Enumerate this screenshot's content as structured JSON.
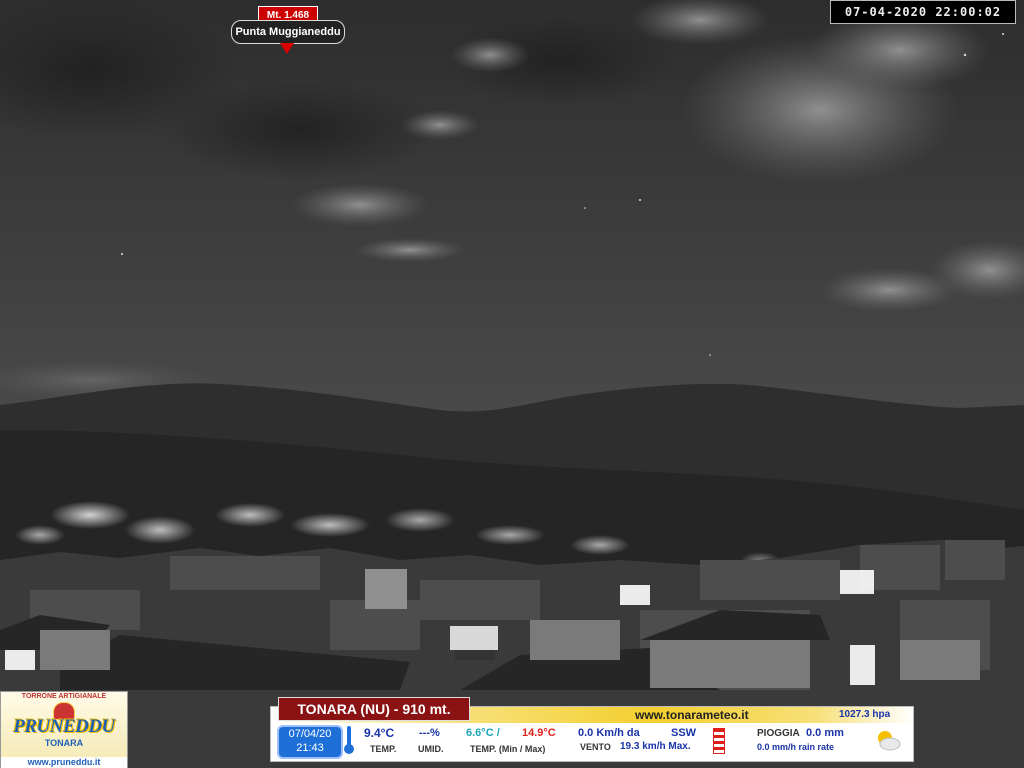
{
  "webcam": {
    "timestamp": "07-04-2020  22:00:02",
    "landmark": {
      "altitude": "Mt. 1.468",
      "name": "Punta Muggianeddu"
    }
  },
  "sponsor": {
    "tagline": "TORRONE ARTIGIANALE",
    "brand": "PRUNEDDU",
    "town": "TONARA",
    "url": "www.pruneddu.it"
  },
  "weather": {
    "station": "TONARA (NU) - 910 mt.",
    "site": "www.tonarameteo.it",
    "pressure": "1027.3  hpa",
    "date": "07/04/20",
    "time": "21:43",
    "temp": "9.4°C",
    "temp_label": "TEMP.",
    "humidity": "---%",
    "humidity_label": "UMID.",
    "temp_min": "6.6°C /",
    "temp_max": "14.9°C",
    "minmax_label": "TEMP. (Min / Max)",
    "wind": "0.0 Km/h da",
    "wind_dir": "SSW",
    "wind_label": "VENTO",
    "wind_max": "19.3  km/h Max.",
    "rain_label": "PIOGGIA",
    "rain": "0.0 mm",
    "rain_rate": "0.0 mm/h rain rate",
    "colors": {
      "accent_blue": "#1e6fd8",
      "station_red": "#8b1212",
      "min_teal": "#1aa6b7",
      "max_red": "#e0201a",
      "text_blue": "#1933a8"
    },
    "icons": [
      "thermometer-icon",
      "rain-gauge-icon",
      "partly-cloudy-icon"
    ]
  }
}
